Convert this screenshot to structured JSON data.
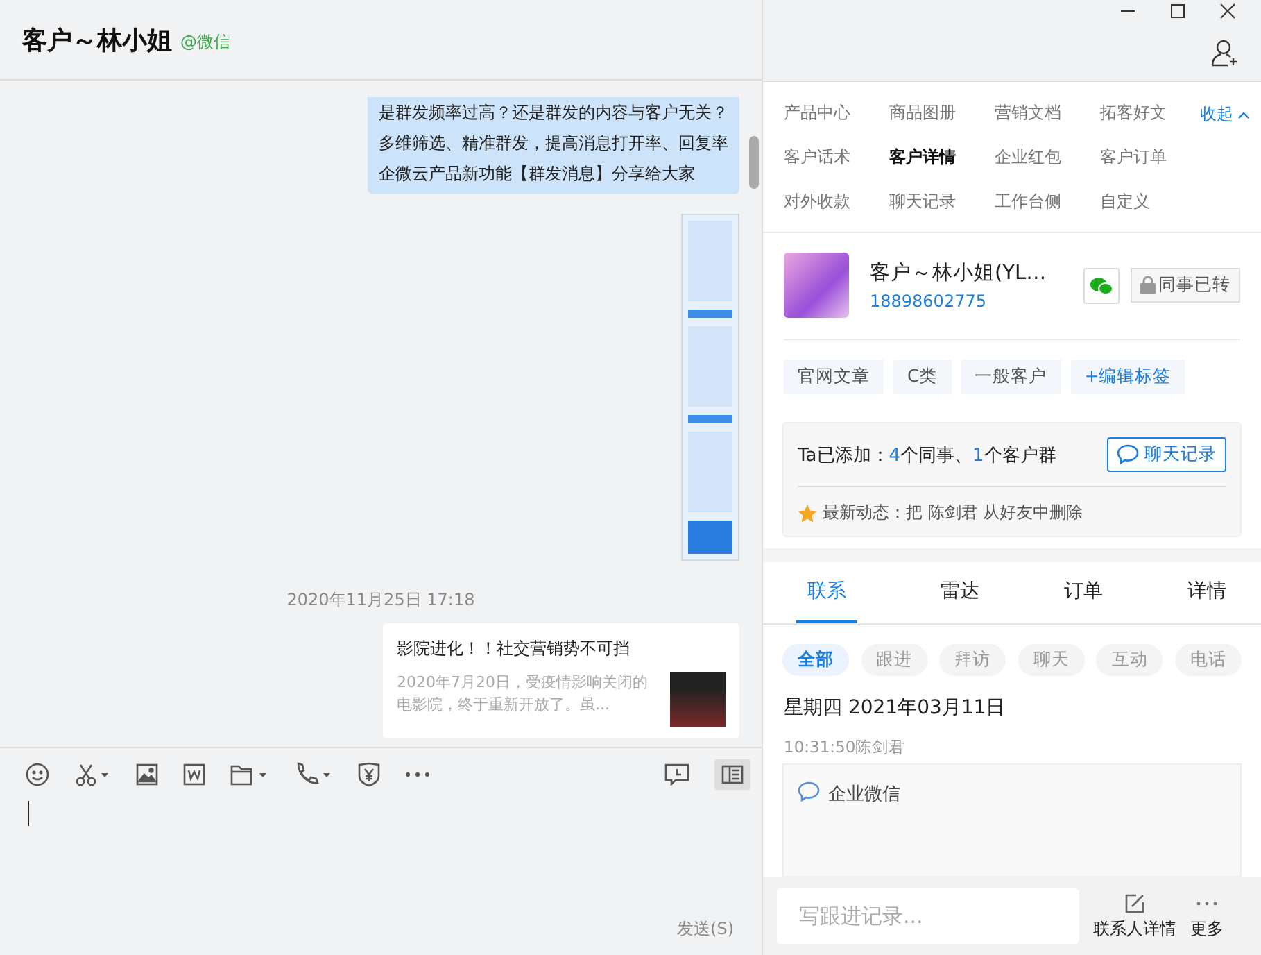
{
  "chat": {
    "title": "客户～林小姐",
    "source": "@微信"
  },
  "messages": [
    {
      "kind": "text",
      "lines": [
        "是群发频率过高？还是群发的内容与客户无关？",
        "多维筛选、精准群发，提高消息打开率、回复率",
        "企微云产品新功能【群发消息】分享给大家"
      ]
    },
    {
      "kind": "image"
    },
    {
      "kind": "time",
      "text": "2020年11月25日 17:18"
    },
    {
      "kind": "link",
      "title": "影院进化！！社交营销势不可挡",
      "desc": "2020年7月20日，受疫情影响关闭的电影院，终于重新开放了。虽..."
    }
  ],
  "send_label": "发送(S)",
  "apps": {
    "items": [
      {
        "label": "产品中心",
        "selected": false
      },
      {
        "label": "商品图册",
        "selected": false
      },
      {
        "label": "营销文档",
        "selected": false
      },
      {
        "label": "拓客好文",
        "selected": false
      },
      {
        "label": "客户话术",
        "selected": false
      },
      {
        "label": "客户详情",
        "selected": true
      },
      {
        "label": "企业红包",
        "selected": false
      },
      {
        "label": "客户订单",
        "selected": false
      },
      {
        "label": "对外收款",
        "selected": false
      },
      {
        "label": "聊天记录",
        "selected": false
      },
      {
        "label": "工作台侧",
        "selected": false
      },
      {
        "label": "自定义",
        "selected": false
      }
    ],
    "collapse": "收起"
  },
  "customer": {
    "name": "客户～林小姐(YL…",
    "phone": "18898602775",
    "transfer": "同事已转",
    "tags": [
      "官网文章",
      "C类",
      "一般客户"
    ],
    "edit_tag": "+编辑标签"
  },
  "added": {
    "parts": [
      {
        "text": "Ta已添加：",
        "highlight": false
      },
      {
        "text": "4",
        "highlight": true
      },
      {
        "text": "个同事、",
        "highlight": false
      },
      {
        "text": "1",
        "highlight": true
      },
      {
        "text": "个客户群",
        "highlight": false
      }
    ],
    "button": "聊天记录",
    "activity": "最新动态：把 陈剑君 从好友中删除"
  },
  "tabs": [
    {
      "label": "联系",
      "selected": true
    },
    {
      "label": "雷达",
      "selected": false
    },
    {
      "label": "订单",
      "selected": false
    },
    {
      "label": "详情",
      "selected": false
    }
  ],
  "filters": [
    {
      "label": "全部",
      "selected": true
    },
    {
      "label": "跟进",
      "selected": false
    },
    {
      "label": "拜访",
      "selected": false
    },
    {
      "label": "聊天",
      "selected": false
    },
    {
      "label": "互动",
      "selected": false
    },
    {
      "label": "电话",
      "selected": false
    }
  ],
  "date": "星期四  2021年03月11日",
  "record": {
    "meta": "10:31:50陈剑君",
    "channel": "企业微信"
  },
  "footer": {
    "placeholder": "写跟进记录...",
    "actions": [
      {
        "kind": "edit",
        "label": "联系人详情"
      },
      {
        "kind": "more",
        "label": "更多"
      }
    ]
  }
}
